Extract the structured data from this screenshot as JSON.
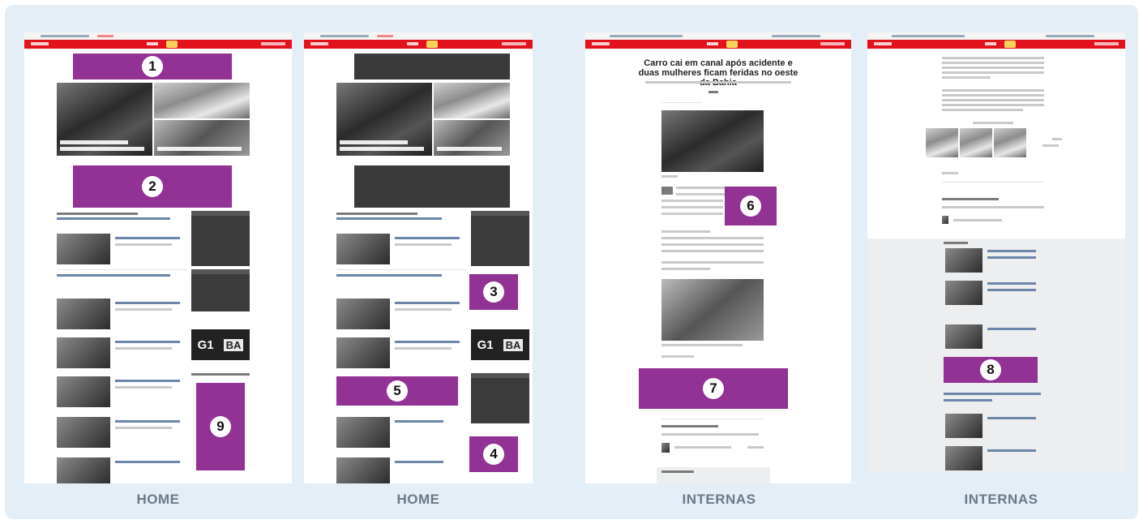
{
  "captions": [
    "HOME",
    "HOME",
    "INTERNAS",
    "INTERNAS"
  ],
  "ad_markers": [
    "1",
    "2",
    "3",
    "4",
    "5",
    "6",
    "7",
    "8",
    "9"
  ],
  "panels": [
    {
      "name": "home-wireframe-a",
      "caption": "HOME"
    },
    {
      "name": "home-wireframe-b",
      "caption": "HOME"
    },
    {
      "name": "internas-wireframe-a",
      "caption": "INTERNAS"
    },
    {
      "name": "internas-wireframe-b",
      "caption": "INTERNAS"
    }
  ],
  "article": {
    "headline": "Carro cai em canal após acidente e duas mulheres ficam feridas no oeste da Bahia"
  },
  "g1_logo": {
    "left": "G1",
    "right": "BA"
  },
  "colors": {
    "ad_slot": "#923294",
    "header": "#e1121b",
    "background": "#e3eef7",
    "caption": "#6b7a86"
  }
}
